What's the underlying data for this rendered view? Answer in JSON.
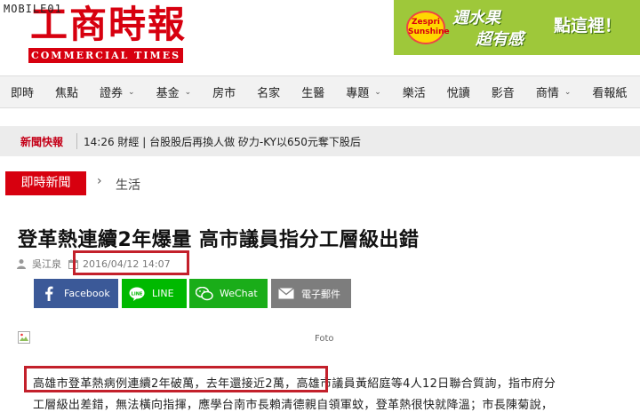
{
  "watermark": "MOBILE01",
  "header": {
    "logo_cn": "工商時報",
    "logo_en": "COMMERCIAL TIMES",
    "ad": {
      "badge": "Zespri Sunshine",
      "line1": "週水果",
      "line2": "超有感",
      "cta": "點這裡！"
    }
  },
  "nav": {
    "items": [
      {
        "label": "即時",
        "dropdown": false
      },
      {
        "label": "焦點",
        "dropdown": false
      },
      {
        "label": "證券",
        "dropdown": true
      },
      {
        "label": "基金",
        "dropdown": true
      },
      {
        "label": "房市",
        "dropdown": false
      },
      {
        "label": "名家",
        "dropdown": false
      },
      {
        "label": "生醫",
        "dropdown": false
      },
      {
        "label": "專題",
        "dropdown": true
      },
      {
        "label": "樂活",
        "dropdown": false
      },
      {
        "label": "悅讀",
        "dropdown": false
      },
      {
        "label": "影音",
        "dropdown": false
      },
      {
        "label": "商情",
        "dropdown": true
      },
      {
        "label": "看報紙",
        "dropdown": false
      }
    ]
  },
  "breaking": {
    "label": "新聞快報",
    "text": "14:26 財經 | 台股股后再換人做 矽力-KY以650元奪下股后"
  },
  "breadcrumb": {
    "section": "即時新聞",
    "category": "生活"
  },
  "article": {
    "title": "登革熱連續2年爆量 高市議員指分工層級出錯",
    "author": "吳江泉",
    "date": "2016/04/12 14:07",
    "image_caption": "Foto",
    "body_line1": "高雄市登革熱病例連續2年破萬，去年還接近2萬，高雄市議員黃紹庭等4人12日聯合質詢，指市府分",
    "body_line2": "工層級出差錯，無法橫向指揮，應學台南市長賴清德親自領軍蚊，登革熱很快就降溫；市長陳菊說，"
  },
  "share": {
    "facebook": "Facebook",
    "line": "LINE",
    "wechat": "WeChat",
    "email": "電子郵件"
  },
  "colors": {
    "brand_red": "#d7000f",
    "highlight_red": "#c3202b",
    "facebook": "#3b5998",
    "line": "#00b900",
    "wechat": "#1aad19",
    "email": "#7d7d7d",
    "ad_green": "#9ec83a"
  },
  "icons": [
    "user-icon",
    "calendar-icon",
    "facebook-icon",
    "line-icon",
    "wechat-icon",
    "mail-icon",
    "broken-image-icon",
    "chevron-right-icon",
    "chevron-down-icon"
  ]
}
